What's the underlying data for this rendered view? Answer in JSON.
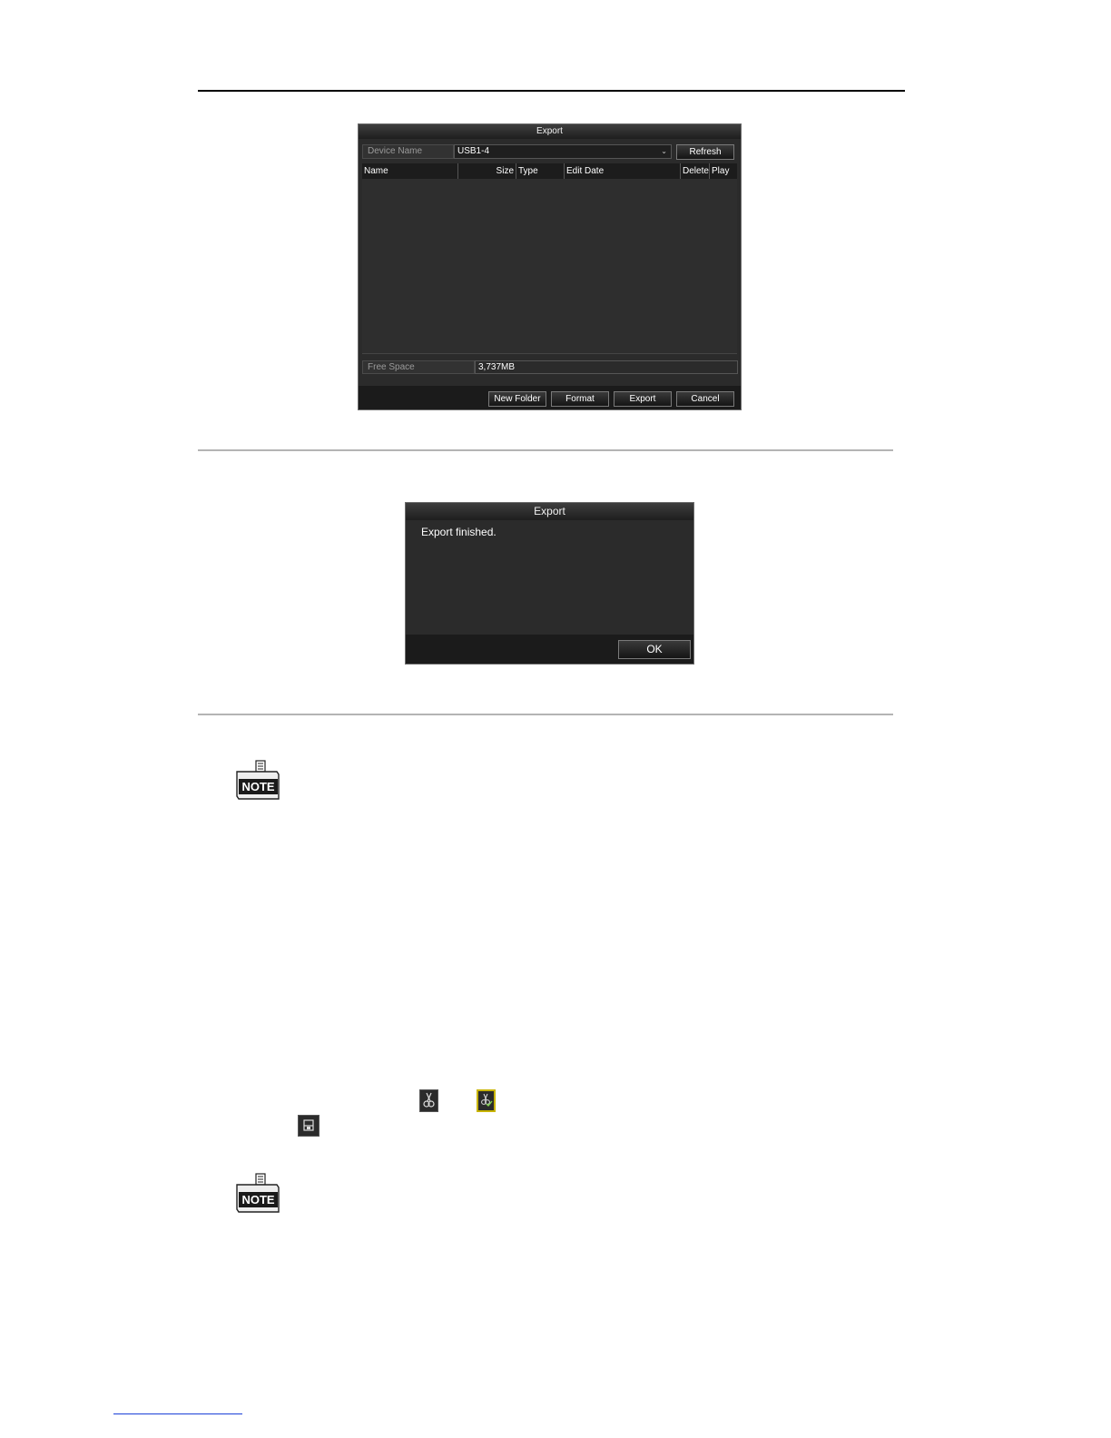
{
  "export_dialog": {
    "title": "Export",
    "device_name_label": "Device Name",
    "device_name_value": "USB1-4",
    "refresh_label": "Refresh",
    "columns": [
      "Name",
      "Size",
      "Type",
      "Edit Date",
      "Delete",
      "Play"
    ],
    "free_space_label": "Free Space",
    "free_space_value": "3,737MB",
    "buttons": {
      "new_folder": "New Folder",
      "format": "Format",
      "export": "Export",
      "cancel": "Cancel"
    }
  },
  "finished_dialog": {
    "title": "Export",
    "message": "Export finished.",
    "ok_label": "OK"
  },
  "notes": [
    {
      "icon": "note-icon",
      "label": "NOTE"
    },
    {
      "icon": "note-icon",
      "label": "NOTE"
    }
  ],
  "inline_icons": [
    "scissors-icon",
    "scissors-check-icon",
    "save-icon"
  ]
}
